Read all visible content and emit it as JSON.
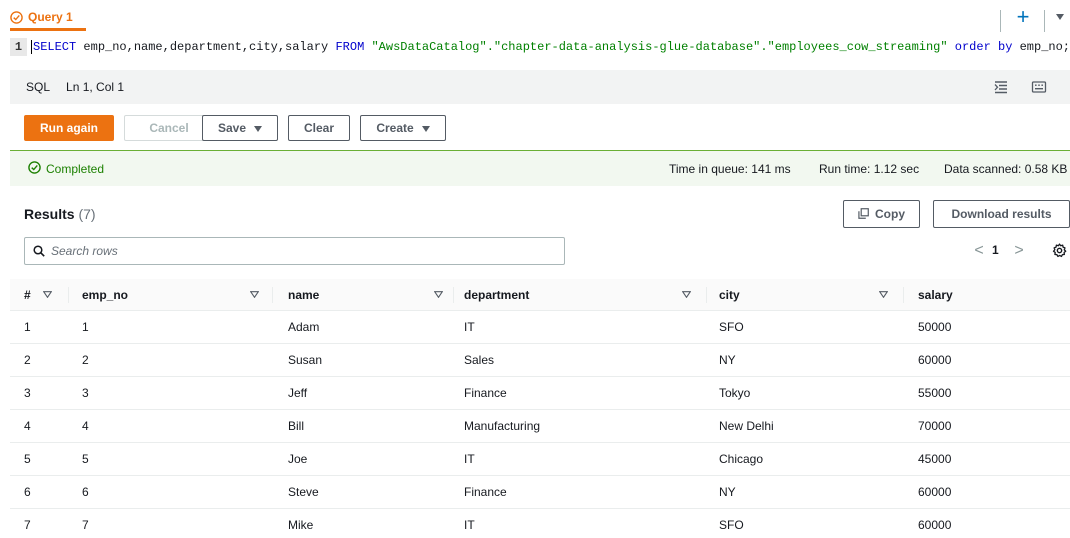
{
  "tab": {
    "label": "Query 1",
    "new_tab": "+"
  },
  "editor": {
    "line_number": "1",
    "kw_select": "SELECT",
    "columns": " emp_no,name,department,city,salary ",
    "kw_from": "FROM",
    "sp1": " ",
    "table_ref": "\"AwsDataCatalog\".\"chapter-data-analysis-glue-database\".\"employees_cow_streaming\"",
    "sp2": " ",
    "kw_order": "order by",
    "tail": " emp_no;"
  },
  "status": {
    "language": "SQL",
    "position": "Ln 1, Col 1"
  },
  "actions": {
    "run_again": "Run again",
    "cancel": "Cancel",
    "save": "Save",
    "clear": "Clear",
    "create": "Create"
  },
  "execution": {
    "state": "Completed",
    "queue_label": "Time in queue:",
    "queue_value": "141 ms",
    "run_label": "Run time:",
    "run_value": "1.12 sec",
    "scanned_label": "Data scanned:",
    "scanned_value": "0.58 KB"
  },
  "results": {
    "title": "Results",
    "count": "(7)",
    "copy": "Copy",
    "download": "Download results",
    "search_placeholder": "Search rows",
    "page": "1",
    "prev": "<",
    "next": ">"
  },
  "table": {
    "columns": [
      "#",
      "emp_no",
      "name",
      "department",
      "city",
      "salary"
    ],
    "rows": [
      [
        "1",
        "1",
        "Adam",
        "IT",
        "SFO",
        "50000"
      ],
      [
        "2",
        "2",
        "Susan",
        "Sales",
        "NY",
        "60000"
      ],
      [
        "3",
        "3",
        "Jeff",
        "Finance",
        "Tokyo",
        "55000"
      ],
      [
        "4",
        "4",
        "Bill",
        "Manufacturing",
        "New Delhi",
        "70000"
      ],
      [
        "5",
        "5",
        "Joe",
        "IT",
        "Chicago",
        "45000"
      ],
      [
        "6",
        "6",
        "Steve",
        "Finance",
        "NY",
        "60000"
      ],
      [
        "7",
        "7",
        "Mike",
        "IT",
        "SFO",
        "60000"
      ]
    ]
  },
  "colors": {
    "accent": "#ec7211",
    "success": "#1d8102",
    "link_blue": "#0073bb"
  }
}
